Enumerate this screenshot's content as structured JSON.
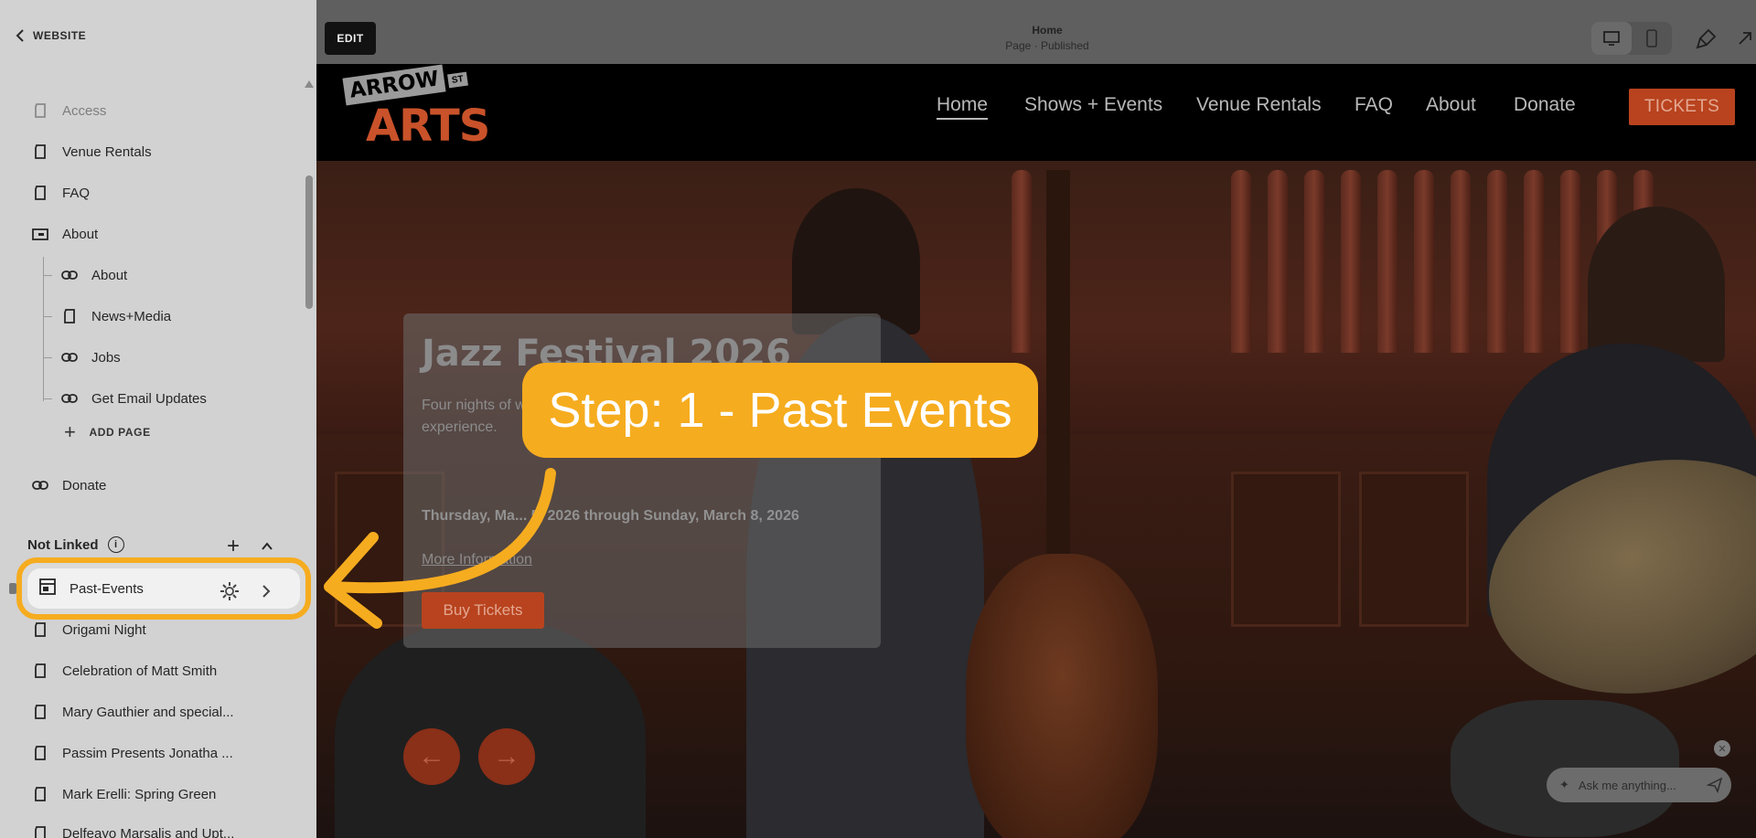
{
  "sidebar": {
    "back_label": "WEBSITE",
    "items": [
      {
        "label": "Access",
        "icon": "page-icon"
      },
      {
        "label": "Venue Rentals",
        "icon": "page-icon"
      },
      {
        "label": "FAQ",
        "icon": "page-icon"
      },
      {
        "label": "About",
        "icon": "folder-icon"
      },
      {
        "label": "About",
        "icon": "link-icon"
      },
      {
        "label": "News+Media",
        "icon": "page-icon"
      },
      {
        "label": "Jobs",
        "icon": "link-icon"
      },
      {
        "label": "Get Email Updates",
        "icon": "link-icon"
      },
      {
        "label": "Donate",
        "icon": "link-icon"
      }
    ],
    "add_page_label": "ADD PAGE",
    "not_linked": {
      "title": "Not Linked",
      "selected": {
        "label": "Past-Events",
        "icon": "events-page-icon"
      },
      "items": [
        "Origami Night",
        "Celebration of Matt Smith",
        "Mary Gauthier and special...",
        "Passim Presents Jonatha ...",
        "Mark Erelli: Spring Green",
        "Delfeayo Marsalis and Upt..."
      ]
    }
  },
  "topbar": {
    "edit_label": "EDIT",
    "page_title": "Home",
    "page_status": "Page · Published"
  },
  "site": {
    "logo_top": "ARROW",
    "logo_st": "ST",
    "logo_bottom": "ARTS",
    "nav": [
      "Home",
      "Shows + Events",
      "Venue Rentals",
      "FAQ",
      "About",
      "Donate"
    ],
    "tickets_label": "TICKETS"
  },
  "hero": {
    "title": "Jazz Festival 2026",
    "description": "Four nights of w... celebration of ja... Davis, and Sulliv... experience.",
    "dates": "Thursday, Ma... 5, 2026 through Sunday, March 8, 2026",
    "more_label": "More Information",
    "buy_label": "Buy Tickets",
    "prev_arrow": "←",
    "next_arrow": "→"
  },
  "assistant": {
    "placeholder": "Ask me anything..."
  },
  "callout": {
    "text": "Step: 1 - Past Events"
  },
  "colors": {
    "accent": "#f6ac1f",
    "brand": "#b8431e",
    "sidebar_bg": "#d2d2d2"
  }
}
